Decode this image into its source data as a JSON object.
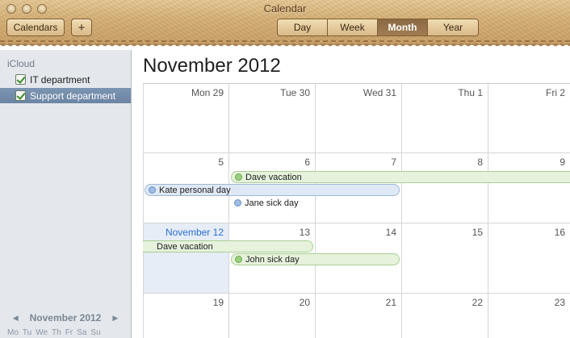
{
  "window": {
    "title": "Calendar"
  },
  "toolbar": {
    "calendars_label": "Calendars",
    "add_label": "+",
    "views": [
      "Day",
      "Week",
      "Month",
      "Year"
    ],
    "active_view": "Month"
  },
  "sidebar": {
    "group": "iCloud",
    "calendars": [
      {
        "label": "IT department",
        "checked": true,
        "selected": false
      },
      {
        "label": "Support department",
        "checked": true,
        "selected": true
      }
    ],
    "mini": {
      "title": "November 2012",
      "prev": "◀",
      "next": "▶",
      "days": [
        "Mo",
        "Tu",
        "We",
        "Th",
        "Fr",
        "Sa",
        "Su"
      ]
    }
  },
  "main": {
    "month_title": "November 2012",
    "rows": [
      [
        "Mon 29",
        "Tue 30",
        "Wed 31",
        "Thu 1",
        "Fri 2"
      ],
      [
        "5",
        "6",
        "7",
        "8",
        "9"
      ],
      [
        "November 12",
        "13",
        "14",
        "15",
        "16"
      ],
      [
        "19",
        "20",
        "21",
        "22",
        "23"
      ]
    ],
    "today": "November 12",
    "events": [
      {
        "label": "Dave vacation",
        "color": "green",
        "dot": true
      },
      {
        "label": "Kate personal day",
        "color": "blue",
        "dot": true
      },
      {
        "label": "Jane sick day",
        "color": "blue",
        "dot": true
      },
      {
        "label": "Dave vacation",
        "color": "green",
        "dot": false
      },
      {
        "label": "John sick day",
        "color": "green",
        "dot": true
      }
    ]
  },
  "colors": {
    "accent": "#2c6ed6",
    "selection": "#7087a6",
    "green_event": "#e6f2dc",
    "blue_event": "#dfe9f5"
  }
}
